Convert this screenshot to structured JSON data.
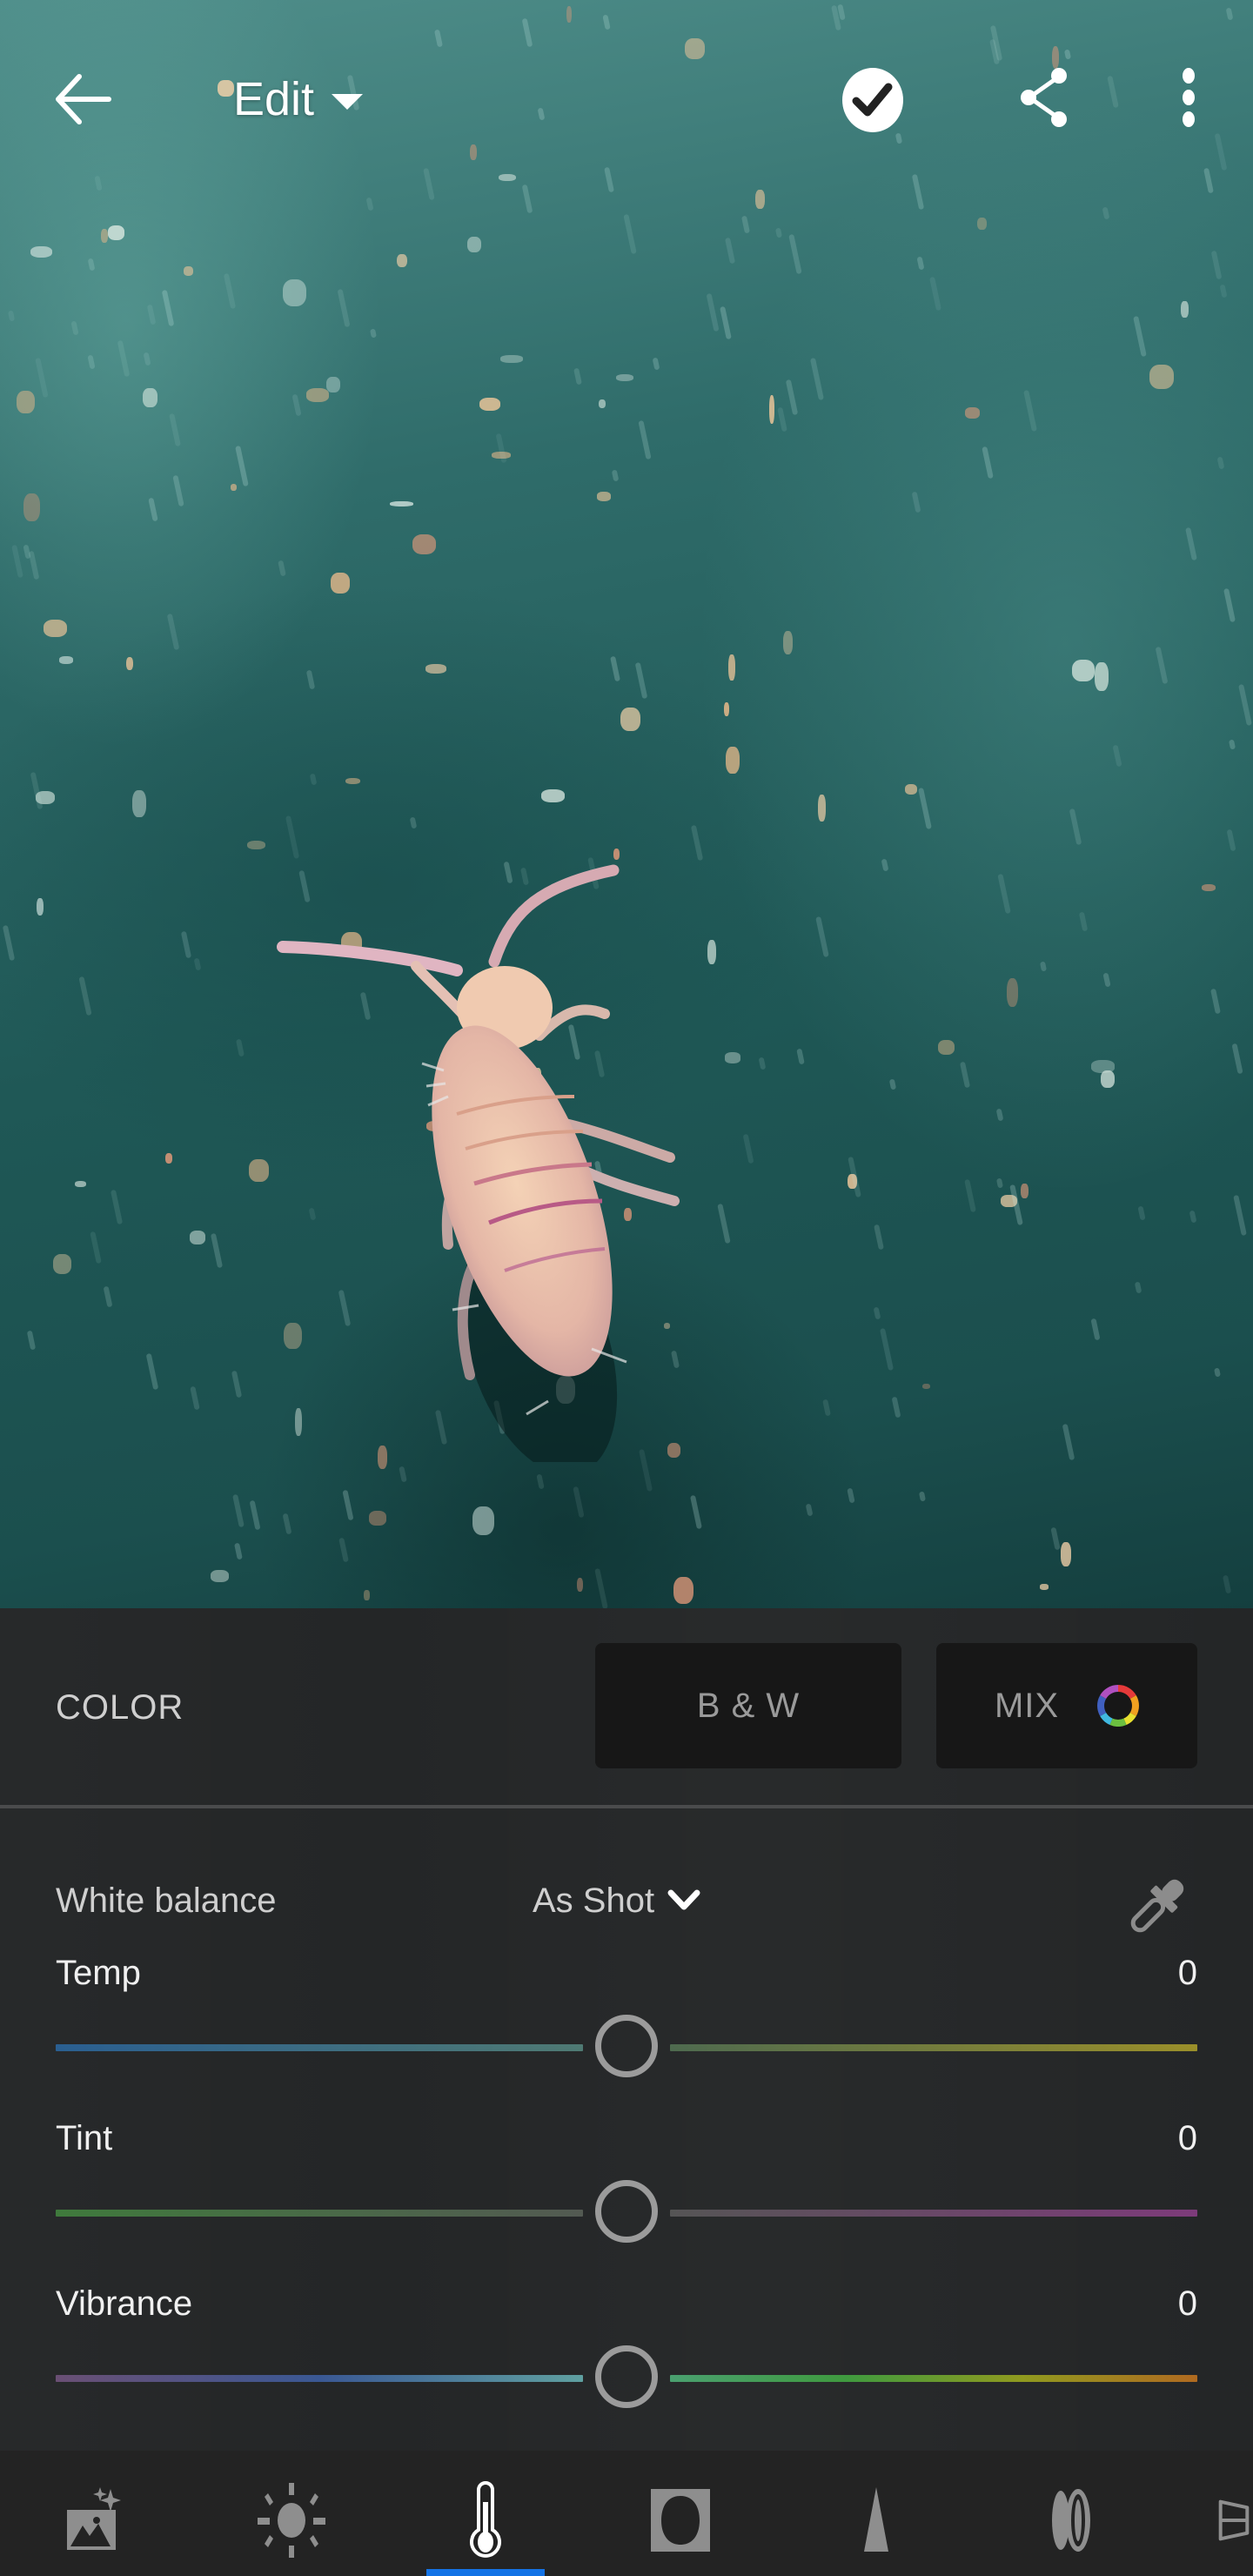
{
  "header": {
    "back_icon": "arrow-left-icon",
    "mode_label": "Edit",
    "mode_caret_icon": "caret-down-icon",
    "done_icon": "checkmark-circle-icon",
    "share_icon": "share-icon",
    "more_icon": "more-vertical-icon"
  },
  "photo": {
    "subject": "springtail insect on teal surface"
  },
  "panel": {
    "section_title": "COLOR",
    "bw_button_label": "B & W",
    "mix_button_label": "MIX",
    "mix_icon": "color-wheel-icon",
    "white_balance": {
      "label": "White balance",
      "selected": "As Shot",
      "chevron_icon": "chevron-down-icon",
      "eyedropper_icon": "eyedropper-icon"
    },
    "sliders": [
      {
        "label": "Temp",
        "value": "0",
        "position_fraction": 0.5,
        "left_colors": [
          "#2a5f91",
          "#4f7a73"
        ],
        "right_colors": [
          "#4e6a4f",
          "#9a8f2a"
        ]
      },
      {
        "label": "Tint",
        "value": "0",
        "position_fraction": 0.5,
        "left_colors": [
          "#3f7a3c",
          "#535a52"
        ],
        "right_colors": [
          "#555555",
          "#7d3b7a"
        ]
      },
      {
        "label": "Vibrance",
        "value": "0",
        "position_fraction": 0.5,
        "left_colors": [
          "#6a4f74",
          "#3a5894",
          "#5fa0a0"
        ],
        "right_colors": [
          "#4aa070",
          "#3f9a3f",
          "#8f9a1f",
          "#b06a20"
        ]
      }
    ]
  },
  "toolbar": {
    "active_index": 2,
    "active_color": "#1473e6",
    "items": [
      {
        "name": "presets",
        "icon": "auto-enhance-photo-icon"
      },
      {
        "name": "light",
        "icon": "sun-icon"
      },
      {
        "name": "color",
        "icon": "thermometer-icon"
      },
      {
        "name": "effects",
        "icon": "vignette-icon"
      },
      {
        "name": "detail",
        "icon": "triangle-detail-icon"
      },
      {
        "name": "optics",
        "icon": "lens-icon"
      },
      {
        "name": "geometry",
        "icon": "geometry-icon"
      }
    ]
  }
}
